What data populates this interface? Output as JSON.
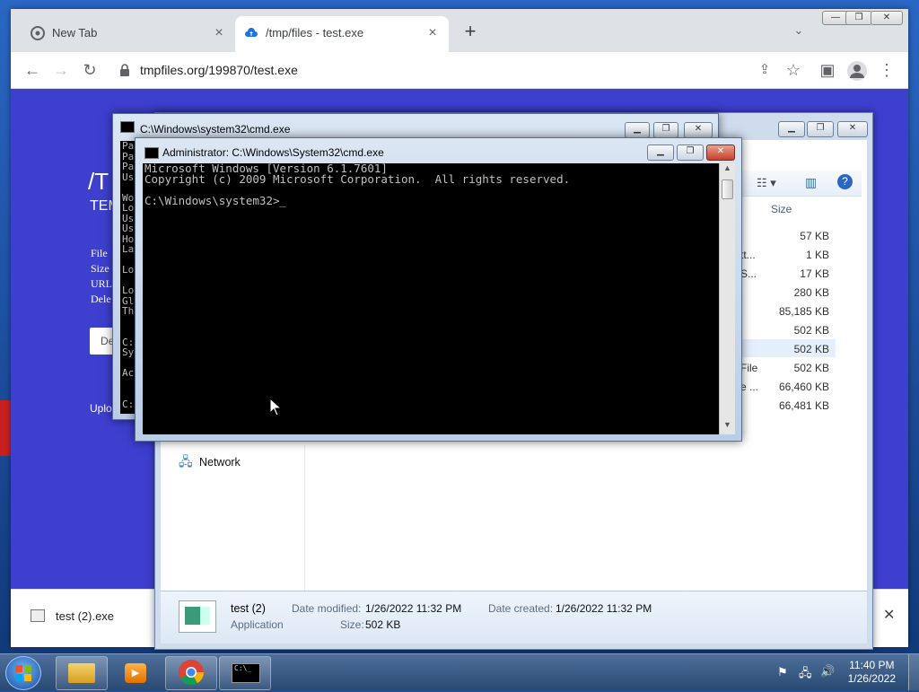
{
  "browser": {
    "tabs": [
      {
        "title": "New Tab",
        "close": "×"
      },
      {
        "title": "/tmp/files - test.exe",
        "close": "×"
      }
    ],
    "new_tab": "+",
    "tab_search": "⌄",
    "url": "tmpfiles.org/199870/test.exe",
    "window_controls": [
      "—",
      "❐",
      "✕"
    ]
  },
  "download_bar": {
    "file_name": "test (2).exe",
    "close": "✕"
  },
  "explorer": {
    "column_header": "Size",
    "sizes": [
      "57 KB",
      "1 KB",
      "17 KB",
      "280 KB",
      "85,185 KB",
      "502 KB",
      "502 KB",
      "502 KB",
      "66,460 KB",
      "66,481 KB"
    ],
    "name_fragments": [
      "tt...",
      "S...",
      "File",
      "e ..."
    ],
    "nav_network": "Network",
    "details": {
      "name": "test (2)",
      "type": "Application",
      "date_modified_label": "Date modified:",
      "date_modified": "1/26/2022 11:32 PM",
      "size_label": "Size:",
      "size": "502 KB",
      "date_created_label": "Date created:",
      "date_created": "1/26/2022 11:32 PM"
    }
  },
  "cmd_back": {
    "title": "C:\\Windows\\system32\\cmd.exe",
    "visible_left": "Pa\nPa\nPa\nUs\n\nWo\nLo\nUs\nUs\nHo\nLa\n\nLo\n\nLo\nGl\nTh\n\n\nC:\nSy\n\nAc\n\n\nC:"
  },
  "cmd_front": {
    "title": "Administrator: C:\\Windows\\System32\\cmd.exe",
    "console": "Microsoft Windows [Version 6.1.7601]\nCopyright (c) 2009 Microsoft Corporation.  All rights reserved.\n\nC:\\Windows\\system32>_"
  },
  "page_fragments": {
    "heading": "/T",
    "sub": "TEM",
    "labels": [
      "File",
      "Size",
      "URL",
      "Dele"
    ],
    "button": "De",
    "upload": "Uplo"
  },
  "taskbar": {
    "time": "11:40 PM",
    "date": "1/26/2022"
  }
}
